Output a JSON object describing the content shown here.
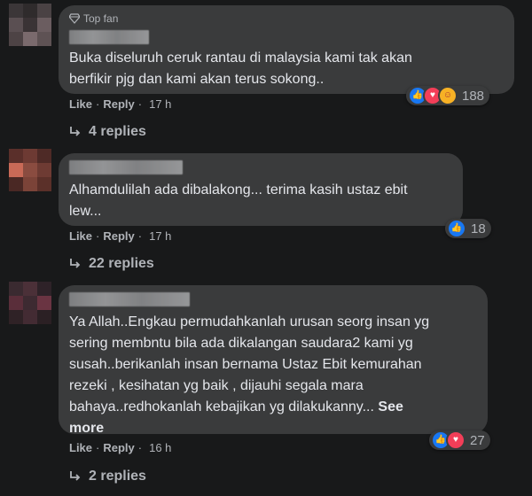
{
  "colors": {
    "background": "#18191a",
    "bubble": "#3a3b3c",
    "primary_text": "#e4e6eb",
    "secondary_text": "#b0b3b8",
    "like_blue": "#1877f2",
    "love_red": "#f33e58",
    "care_yellow": "#f7b125"
  },
  "comments": [
    {
      "badge": "Top fan",
      "text": "Buka diseluruh ceruk rantau di malaysia kami tak akan\nberfikir pjg dan kami akan terus sokong..",
      "reactions": {
        "icons": [
          "like-icon",
          "love-icon",
          "care-icon"
        ],
        "count": "188"
      },
      "like_label": "Like",
      "reply_label": "Reply",
      "time": "17 h",
      "replies_label": "4 replies"
    },
    {
      "text": "Alhamdulilah ada dibalakong... terima kasih ustaz ebit\nlew...",
      "reactions": {
        "icons": [
          "like-icon"
        ],
        "count": "18"
      },
      "like_label": "Like",
      "reply_label": "Reply",
      "time": "17 h",
      "replies_label": "22 replies"
    },
    {
      "text": "Ya Allah..Engkau permudahkanlah urusan seorg insan yg\nsering membntu bila ada dikalangan saudara2 kami yg\nsusah..berikanlah insan bernama Ustaz Ebit kemurahan\nrezeki , kesihatan yg baik , dijauhi segala mara\nbahaya..redhokanlah kebajikan yg dilakukanny... ",
      "see_more": "See\nmore",
      "reactions": {
        "icons": [
          "like-icon",
          "love-icon"
        ],
        "count": "27"
      },
      "like_label": "Like",
      "reply_label": "Reply",
      "time": "16 h",
      "replies_label": "2 replies"
    }
  ]
}
